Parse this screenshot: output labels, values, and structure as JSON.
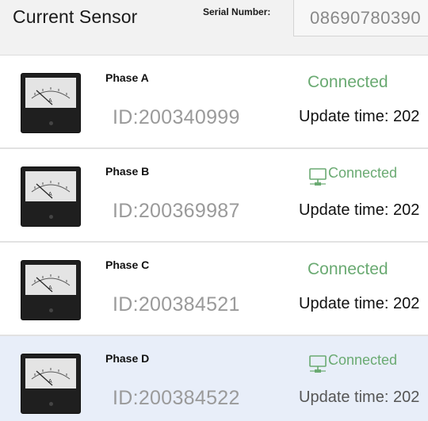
{
  "header": {
    "title": "Current Sensor",
    "serial_label": "Serial Number:",
    "serial_value": "08690780390"
  },
  "colors": {
    "connected": "#6aaa72",
    "selected_row": "#e8eef9"
  },
  "sensors": [
    {
      "phase": "Phase A",
      "id": "ID:200340999",
      "status": "Connected",
      "status_icon": "none",
      "update": "Update time: 202"
    },
    {
      "phase": "Phase B",
      "id": "ID:200369987",
      "status": "Connected",
      "status_icon": "network-monitor-icon",
      "update": "Update time: 202"
    },
    {
      "phase": "Phase C",
      "id": "ID:200384521",
      "status": "Connected",
      "status_icon": "none",
      "update": "Update time: 202"
    },
    {
      "phase": "Phase D",
      "id": "ID:200384522",
      "status": "Connected",
      "status_icon": "network-monitor-icon",
      "update": "Update time: 202"
    }
  ]
}
